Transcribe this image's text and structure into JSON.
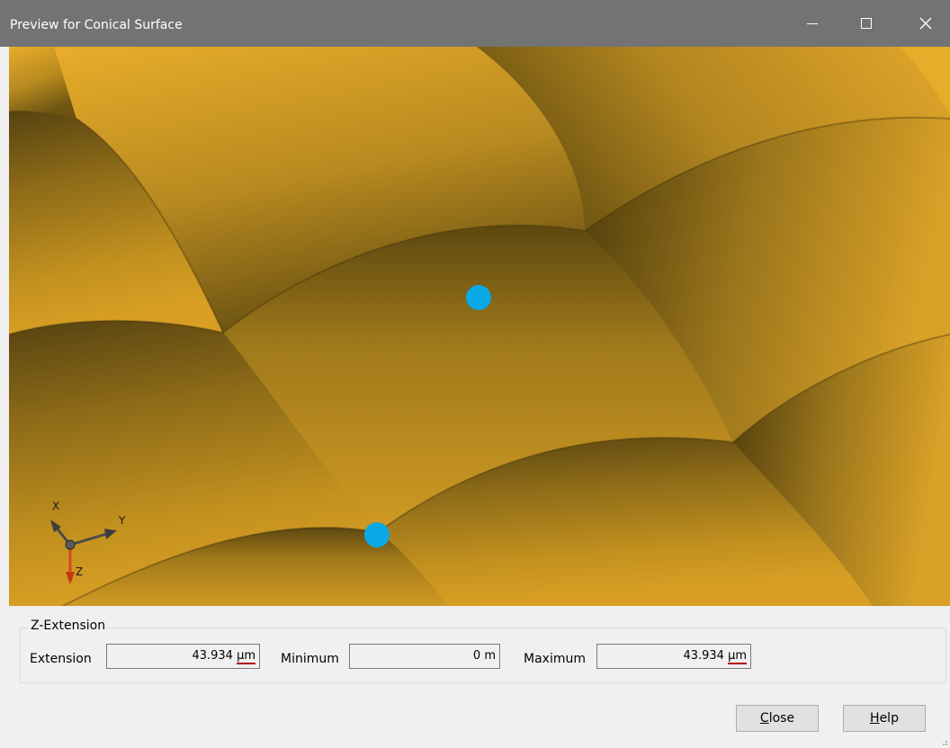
{
  "window": {
    "title": "Preview for Conical Surface",
    "controls": {
      "minimize_icon": "minimize-icon",
      "maximize_icon": "maximize-icon",
      "close_icon": "close-icon"
    }
  },
  "viewport": {
    "surface_color": "#e3a928",
    "marker_color": "#0aa9e6",
    "triad": {
      "x_label": "X",
      "y_label": "Y",
      "z_label": "Z",
      "z_axis_color": "#e0461c"
    }
  },
  "z_extension": {
    "group_title": "Z-Extension",
    "extension": {
      "label": "Extension",
      "value": "43.934",
      "unit": "µm"
    },
    "minimum": {
      "label": "Minimum",
      "value": "0",
      "unit": "m"
    },
    "maximum": {
      "label": "Maximum",
      "value": "43.934",
      "unit": "µm"
    }
  },
  "buttons": {
    "close": {
      "mnemonic": "C",
      "rest": "lose"
    },
    "help": {
      "mnemonic": "H",
      "rest": "elp"
    }
  }
}
